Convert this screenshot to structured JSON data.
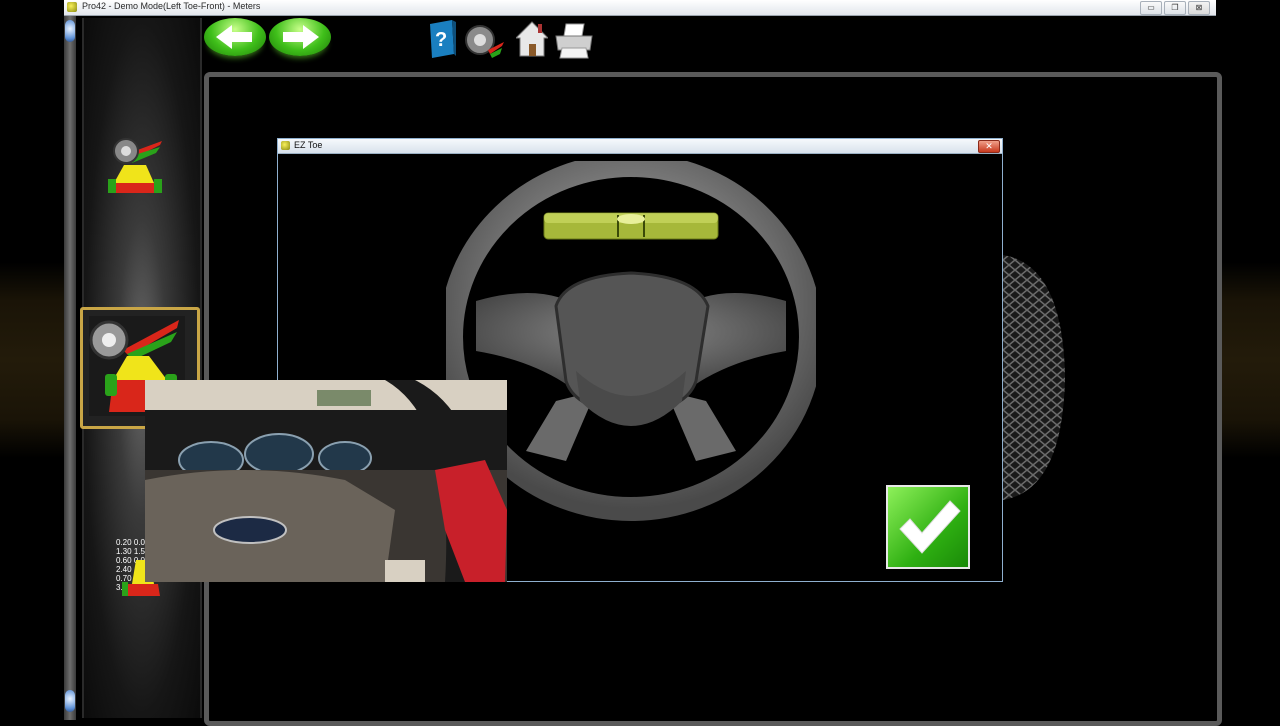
{
  "window": {
    "title": "Pro42 - Demo Mode(Left Toe-Front) - Meters",
    "minimize": "▭",
    "restore": "❐",
    "close": "⊠"
  },
  "toolbar": {
    "icons": [
      "back-arrow-icon",
      "forward-arrow-icon",
      "help-icon",
      "measure-icon",
      "home-icon",
      "print-icon"
    ]
  },
  "sidebar": {
    "meter_values": [
      "0.20",
      "0.0",
      "1.30",
      "1.5",
      "0.60",
      "0.0",
      "2.40",
      "0.70",
      "3."
    ]
  },
  "dialog": {
    "title": "EZ Toe",
    "close_label": "✕"
  },
  "colors": {
    "accent_green": "#3fbf1a",
    "selected_border": "#c9a646",
    "dialog_border": "#8fb0cf"
  }
}
